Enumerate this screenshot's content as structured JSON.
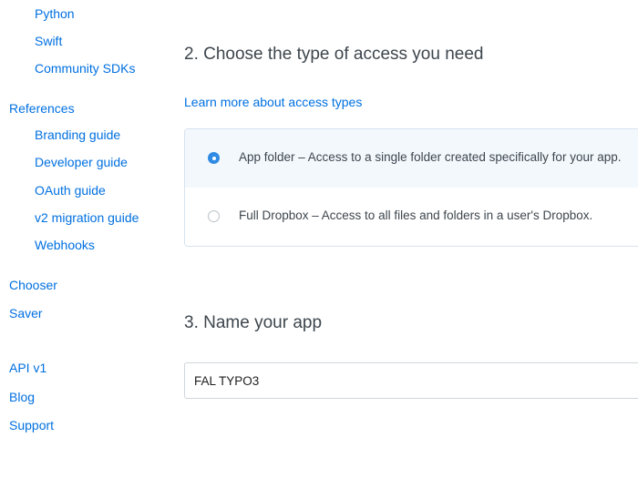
{
  "sidebar": {
    "items": [
      {
        "label": "Python",
        "level": "sub"
      },
      {
        "label": "Swift",
        "level": "sub"
      },
      {
        "label": "Community SDKs",
        "level": "sub"
      },
      {
        "label": "References",
        "level": "top"
      },
      {
        "label": "Branding guide",
        "level": "sub"
      },
      {
        "label": "Developer guide",
        "level": "sub"
      },
      {
        "label": "OAuth guide",
        "level": "sub"
      },
      {
        "label": "v2 migration guide",
        "level": "sub"
      },
      {
        "label": "Webhooks",
        "level": "sub"
      },
      {
        "label": "Chooser",
        "level": "top"
      },
      {
        "label": "Saver",
        "level": "top"
      },
      {
        "label": "API v1",
        "level": "top"
      },
      {
        "label": "Blog",
        "level": "top"
      },
      {
        "label": "Support",
        "level": "top"
      }
    ]
  },
  "access_section": {
    "title": "2. Choose the type of access you need",
    "learn_more_label": "Learn more about access types",
    "options": [
      {
        "label": "App folder – Access to a single folder created specifically for your app.",
        "selected": true
      },
      {
        "label": "Full Dropbox – Access to all files and folders in a user's Dropbox.",
        "selected": false
      }
    ]
  },
  "name_section": {
    "title": "3. Name your app",
    "input_value": "FAL TYPO3"
  },
  "colors": {
    "link": "#0070e0",
    "heading": "#3d464d",
    "selected_bg": "#f3f8fd",
    "radio_accent": "#2f8be3",
    "border": "#d6e2ee"
  }
}
